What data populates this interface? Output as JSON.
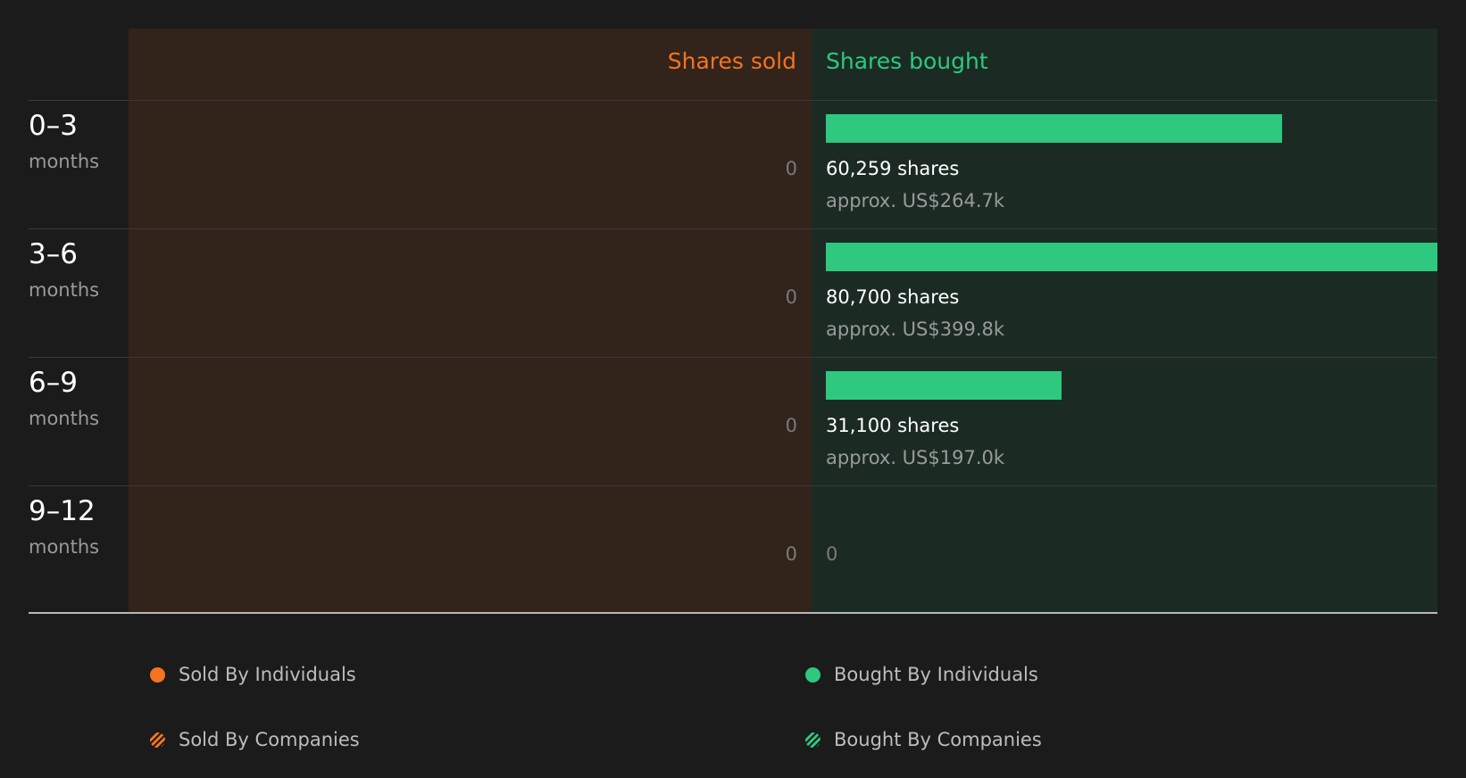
{
  "chart_data": {
    "type": "bar",
    "orientation": "horizontal-diverging",
    "columns": {
      "sold_title": "Shares sold",
      "bought_title": "Shares bought"
    },
    "categories": [
      {
        "period": "0–3",
        "unit": "months"
      },
      {
        "period": "3–6",
        "unit": "months"
      },
      {
        "period": "6–9",
        "unit": "months"
      },
      {
        "period": "9–12",
        "unit": "months"
      }
    ],
    "series": [
      {
        "name": "Sold By Individuals",
        "side": "sold",
        "values": [
          0,
          0,
          0,
          0
        ],
        "labels": [
          "0",
          "0",
          "0",
          "0"
        ]
      },
      {
        "name": "Bought By Individuals",
        "side": "bought",
        "values": [
          60259,
          80700,
          31100,
          0
        ],
        "labels": [
          "60,259 shares",
          "80,700 shares",
          "31,100 shares",
          "0"
        ],
        "approx_values": [
          "approx. US$264.7k",
          "approx. US$399.8k",
          "approx. US$197.0k",
          ""
        ]
      }
    ],
    "xlim": [
      0,
      80700
    ],
    "legend": {
      "position": "bottom",
      "items": [
        {
          "label": "Sold By Individuals",
          "color": "#f47421",
          "pattern": "solid"
        },
        {
          "label": "Bought By Individuals",
          "color": "#2ec87f",
          "pattern": "solid"
        },
        {
          "label": "Sold By Companies",
          "color": "#f47421",
          "pattern": "hatched"
        },
        {
          "label": "Bought By Companies",
          "color": "#2ec87f",
          "pattern": "hatched"
        }
      ]
    },
    "colors": {
      "sold": "#f47421",
      "bought": "#2ec87f",
      "sold_background": "#32231b",
      "bought_background": "#1b2b24",
      "page_background": "#1b1b1b"
    }
  }
}
